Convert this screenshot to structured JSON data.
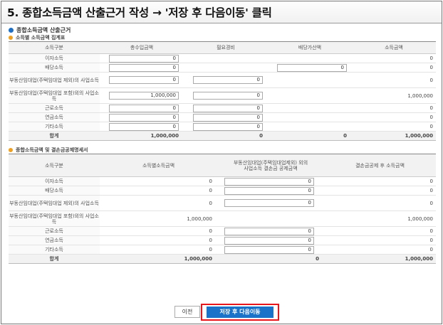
{
  "banner": "5. 종합소득금액 산출근거 작성 → '저장 후 다음이동' 클릭",
  "section_title": "종합소득금액 산출근거",
  "table1": {
    "title": "소득별 소득금액 집계표",
    "headers": [
      "소득구분",
      "총수입금액",
      "필요경비",
      "배당가산액",
      "소득금액"
    ],
    "rows": [
      {
        "label": "이자소득",
        "revenue": "0",
        "expense": null,
        "dividend": null,
        "income": "0"
      },
      {
        "label": "배당소득",
        "revenue": "0",
        "expense": null,
        "dividend": "0",
        "income": "0"
      },
      {
        "label": "부동산임대업(주택임대업 제외)의 사업소득",
        "revenue": "0",
        "expense": "0",
        "dividend": null,
        "income": "0"
      },
      {
        "label": "부동산임대업(주택임대업 포함)외의 사업소득",
        "revenue": "1,000,000",
        "expense": "0",
        "dividend": null,
        "income": "1,000,000"
      },
      {
        "label": "근로소득",
        "revenue": "0",
        "expense": "0",
        "dividend": null,
        "income": "0"
      },
      {
        "label": "연금소득",
        "revenue": "0",
        "expense": "0",
        "dividend": null,
        "income": "0"
      },
      {
        "label": "기타소득",
        "revenue": "0",
        "expense": "0",
        "dividend": null,
        "income": "0"
      }
    ],
    "total": {
      "label": "합계",
      "revenue": "1,000,000",
      "expense": "0",
      "dividend": "0",
      "income": "1,000,000"
    }
  },
  "table2": {
    "title": "종합소득금액 및 결손금공제명세서",
    "headers": [
      "소득구분",
      "소득별소득금액",
      "부동산임대업(주택임대업제외) 외의 사업소득 결손금 공제금액",
      "결손금공제 후 소득금액"
    ],
    "rows": [
      {
        "label": "이자소득",
        "amount": "0",
        "deduction": "0",
        "after": "0"
      },
      {
        "label": "배당소득",
        "amount": "0",
        "deduction": "0",
        "after": "0"
      },
      {
        "label": "부동산임대업(주택임대업 제외)의 사업소득",
        "amount": "0",
        "deduction": "0",
        "after": "0"
      },
      {
        "label": "부동산임대업(주택임대업 포함)외의 사업소득",
        "amount": "1,000,000",
        "deduction": null,
        "after": "1,000,000"
      },
      {
        "label": "근로소득",
        "amount": "0",
        "deduction": "0",
        "after": "0"
      },
      {
        "label": "연금소득",
        "amount": "0",
        "deduction": "0",
        "after": "0"
      },
      {
        "label": "기타소득",
        "amount": "0",
        "deduction": "0",
        "after": "0"
      }
    ],
    "total": {
      "label": "합계",
      "amount": "1,000,000",
      "deduction": "0",
      "after": "1,000,000"
    }
  },
  "buttons": {
    "prev": "이전",
    "next": "저장 후 다음이동"
  },
  "colors": {
    "accent": "#1a73c9",
    "highlight": "#e8151b",
    "bullet_blue": "#1f6fc5",
    "bullet_orange": "#f0a020"
  }
}
